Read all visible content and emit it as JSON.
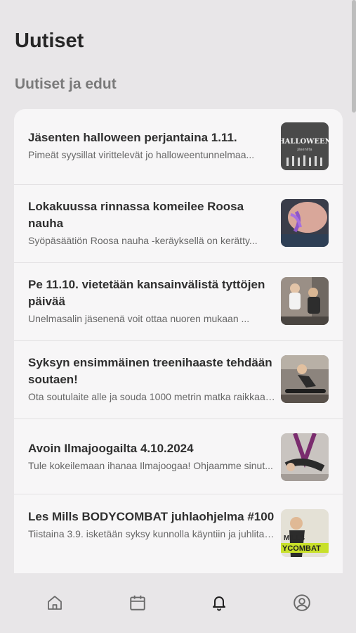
{
  "header": {
    "title": "Uutiset"
  },
  "section": {
    "title": "Uutiset ja edut"
  },
  "news": [
    {
      "title": "Jäsenten halloween perjantaina 1.11.",
      "excerpt": "Pimeät syysillat virittelevät jo halloweentunnelmaa...",
      "image_text": "HALLOWEEN",
      "image_subtext": "Jäsenilta"
    },
    {
      "title": "Lokakuussa rinnassa komeilee Roosa nauha",
      "excerpt": "Syöpäsäätiön Roosa nauha -keräyksellä on kerätty...",
      "image_text": ""
    },
    {
      "title": "Pe 11.10. vietetään kansainvälistä tyttöjen päivää",
      "excerpt": "Unelmasalin jäsenenä voit ottaa nuoren mukaan ...",
      "image_text": ""
    },
    {
      "title": "Syksyn ensimmäinen treenihaaste tehdään soutaen!",
      "excerpt": "Ota soutulaite alle ja souda 1000 metrin matka raikkaasti...",
      "image_text": ""
    },
    {
      "title": "Avoin Ilmajoogailta 4.10.2024",
      "excerpt": "Tule kokeilemaan ihanaa Ilmajoogaa! Ohjaamme sinut...",
      "image_text": ""
    },
    {
      "title": "Les Mills BODYCOMBAT juhlaohjelma #100",
      "excerpt": "Tiistaina 3.9. isketään syksy kunnolla käyntiin ja juhlitaan...",
      "image_text": "MILLS",
      "image_subtext": "YCOMBAT"
    }
  ],
  "tabbar": {
    "items": [
      {
        "icon": "home-icon",
        "active": false
      },
      {
        "icon": "calendar-icon",
        "active": false
      },
      {
        "icon": "bell-icon",
        "active": true
      },
      {
        "icon": "profile-icon",
        "active": false
      }
    ]
  },
  "colors": {
    "background": "#e8e6e8",
    "card": "#f7f6f7",
    "title": "#262626",
    "section": "#7a7a7a",
    "active_tab": "#1f1f1f",
    "inactive_tab": "#6b6b6b"
  }
}
